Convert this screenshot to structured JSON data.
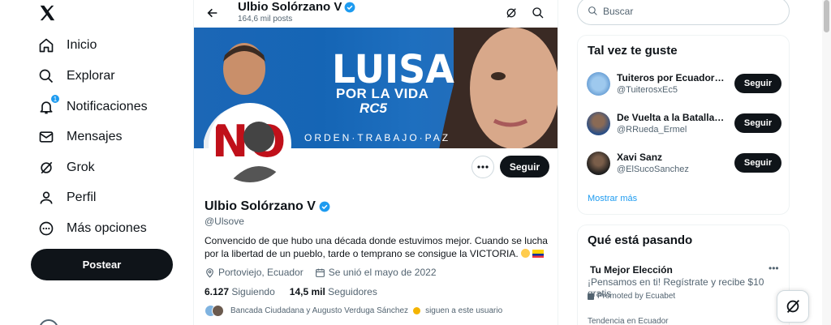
{
  "nav": {
    "items": [
      {
        "label": "Inicio",
        "icon": "home-icon"
      },
      {
        "label": "Explorar",
        "icon": "search-icon"
      },
      {
        "label": "Notificaciones",
        "icon": "bell-icon",
        "badge": "1"
      },
      {
        "label": "Mensajes",
        "icon": "mail-icon"
      },
      {
        "label": "Grok",
        "icon": "grok-icon"
      },
      {
        "label": "Perfil",
        "icon": "user-icon"
      },
      {
        "label": "Más opciones",
        "icon": "more-circle-icon"
      }
    ],
    "post_label": "Postear"
  },
  "header": {
    "name": "Ulbio Solórzano V",
    "posts": "164,6 mil posts"
  },
  "banner": {
    "title": "LUISA",
    "subtitle": "POR LA VIDA",
    "logo": "RC5",
    "slogan": "ORDEN·TRABAJO·PAZ",
    "sign": "NO"
  },
  "profile": {
    "follow_label": "Seguir",
    "name": "Ulbio Solórzano V",
    "handle": "@Ulsove",
    "bio": "Convencido de que hubo una década donde estuvimos mejor. Cuando se lucha por la libertad de un pueblo, tarde o temprano se consigue la VICTORIA.",
    "location": "Portoviejo, Ecuador",
    "joined": "Se unió el mayo de 2022",
    "following_count": "6.127",
    "following_label": "Siguiendo",
    "followers_count": "14,5 mil",
    "followers_label": "Seguidores",
    "followed_by": "Bancada Ciudadana y Augusto Verduga Sánchez",
    "followed_by_suffix": "siguen a este usuario"
  },
  "right": {
    "search_placeholder": "Buscar",
    "suggest_title": "Tal vez te guste",
    "suggestions": [
      {
        "name": "Tuiteros por Ecuador R...",
        "handle": "@TuiterosxEc5",
        "button": "Seguir"
      },
      {
        "name": "De Vuelta a la Batalla, ...",
        "handle": "@RRueda_Ermel",
        "button": "Seguir"
      },
      {
        "name": "Xavi Sanz",
        "handle": "@ElSucoSanchez",
        "button": "Seguir"
      }
    ],
    "show_more": "Mostrar más",
    "trends_title": "Qué está pasando",
    "trend": {
      "title": "Tu Mejor Elección",
      "desc": "¡Pensamos en ti! Regístrate y recibe $10 gratis",
      "promo": "Promoted by Ecuabet",
      "sub": "Tendencia en Ecuador"
    }
  },
  "colors": {
    "accent": "#1d9bf0",
    "dark": "#0f1419",
    "muted": "#536471"
  }
}
